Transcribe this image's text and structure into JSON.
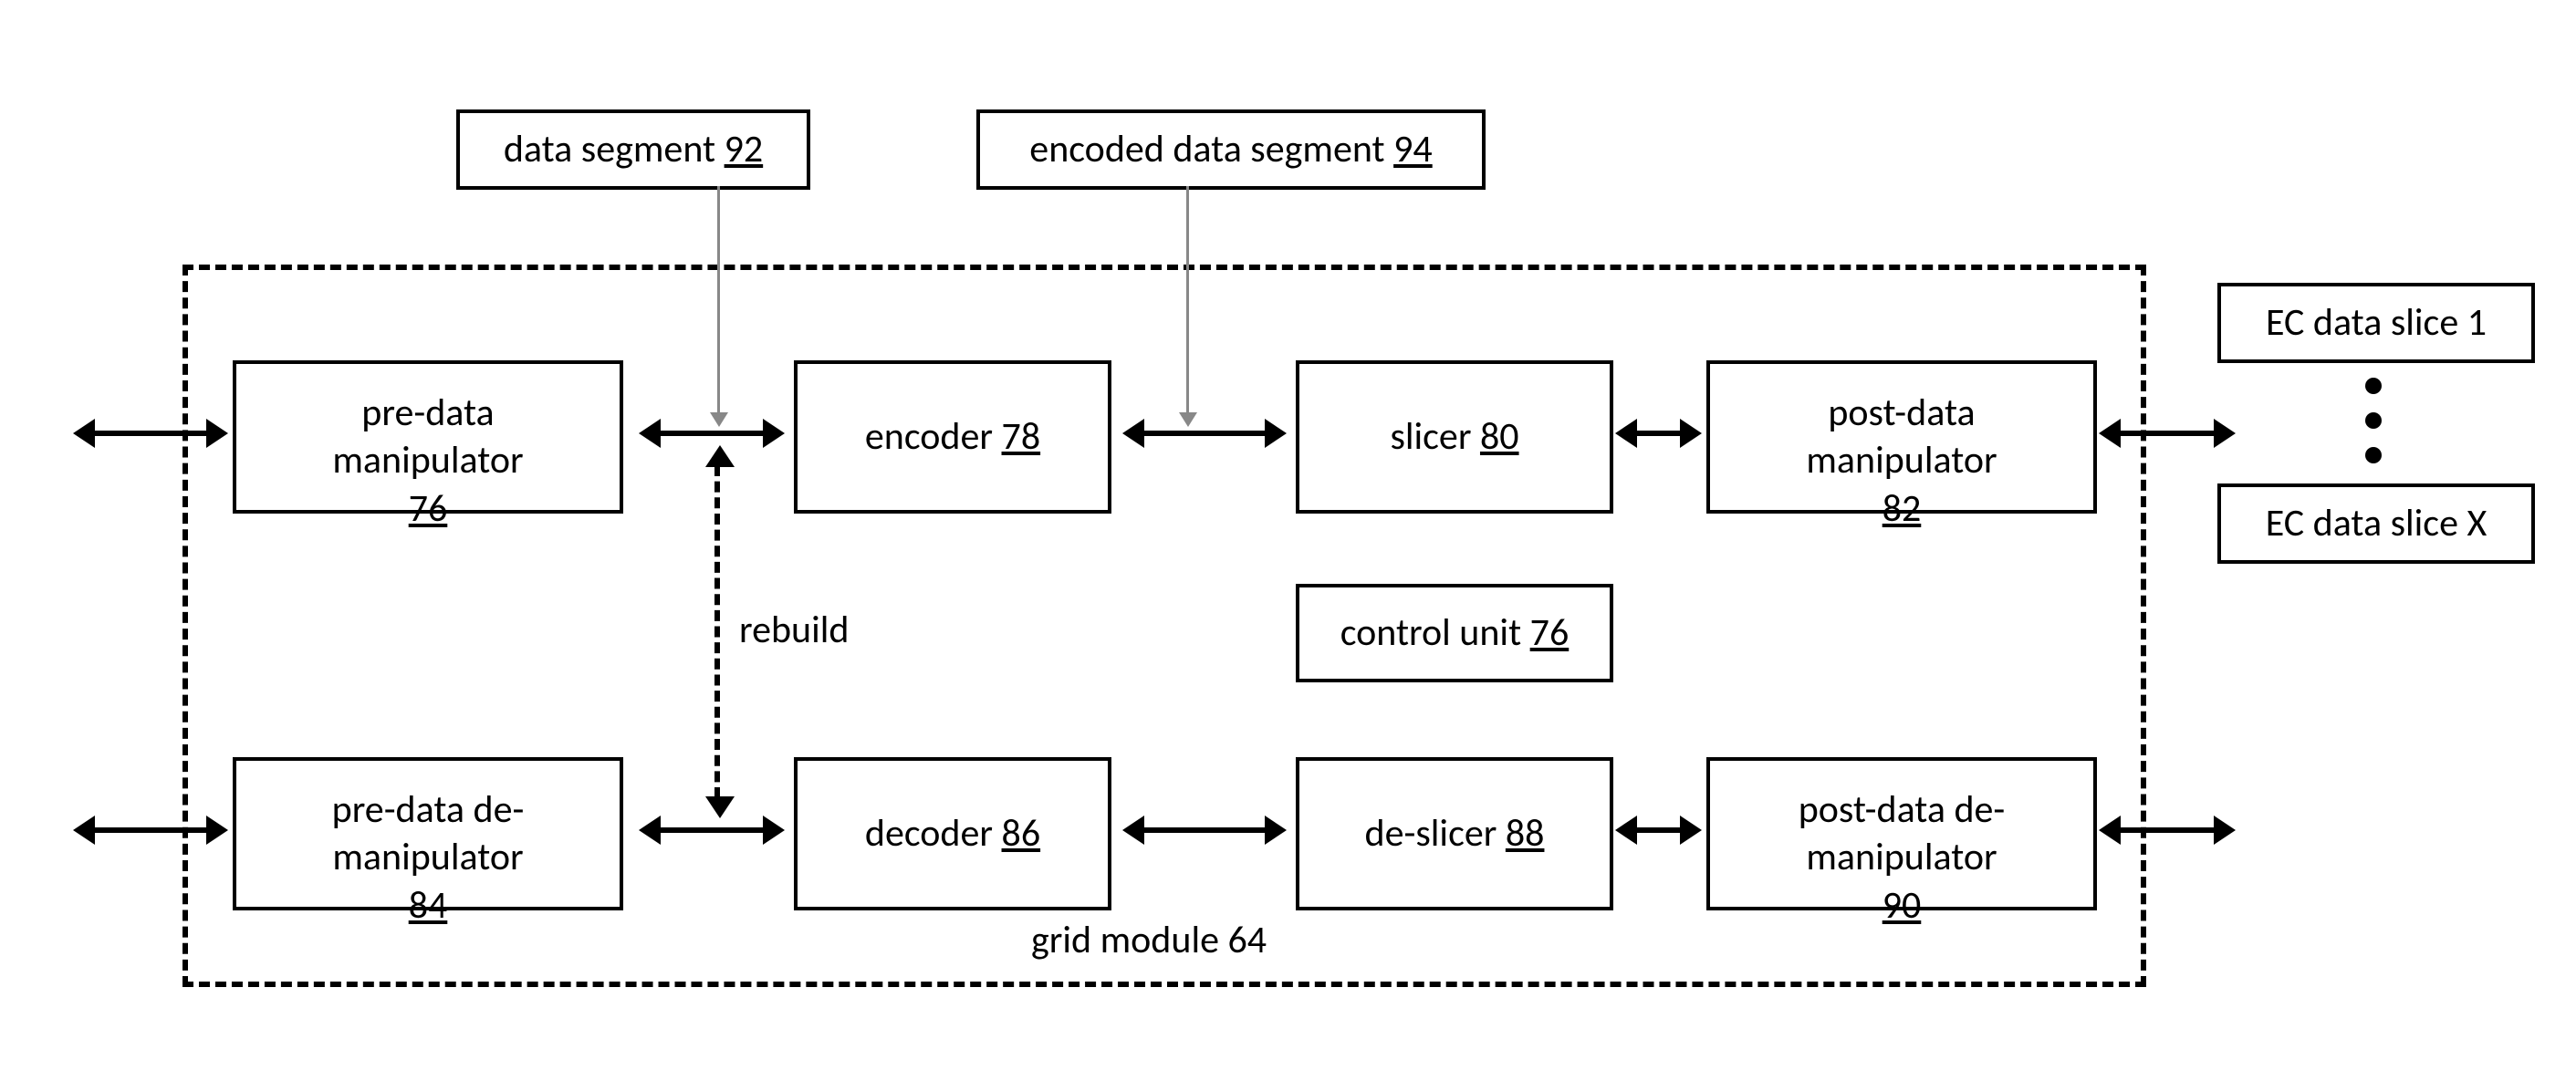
{
  "topLabels": {
    "dataSegment": {
      "text": "data segment",
      "num": "92"
    },
    "encodedSegment": {
      "text": "encoded data segment",
      "num": "94"
    }
  },
  "blocks": {
    "preDataManip": {
      "text": "pre-data\nmanipulator",
      "num": "76"
    },
    "encoder": {
      "text": "encoder",
      "num": "78"
    },
    "slicer": {
      "text": "slicer",
      "num": "80"
    },
    "postDataManip": {
      "text": "post-data\nmanipulator",
      "num": "82"
    },
    "controlUnit": {
      "text": "control unit",
      "num": "76"
    },
    "preDataDeManip": {
      "text": "pre-data de-\nmanipulator",
      "num": "84"
    },
    "decoder": {
      "text": "decoder",
      "num": "86"
    },
    "deSlicer": {
      "text": "de-slicer",
      "num": "88"
    },
    "postDataDeManip": {
      "text": "post-data de-\nmanipulator",
      "num": "90"
    }
  },
  "rebuildLabel": "rebuild",
  "gridModule": {
    "text": "grid module",
    "num": "64"
  },
  "ecSlices": {
    "first": "EC  data slice 1",
    "last": "EC data slice X"
  }
}
